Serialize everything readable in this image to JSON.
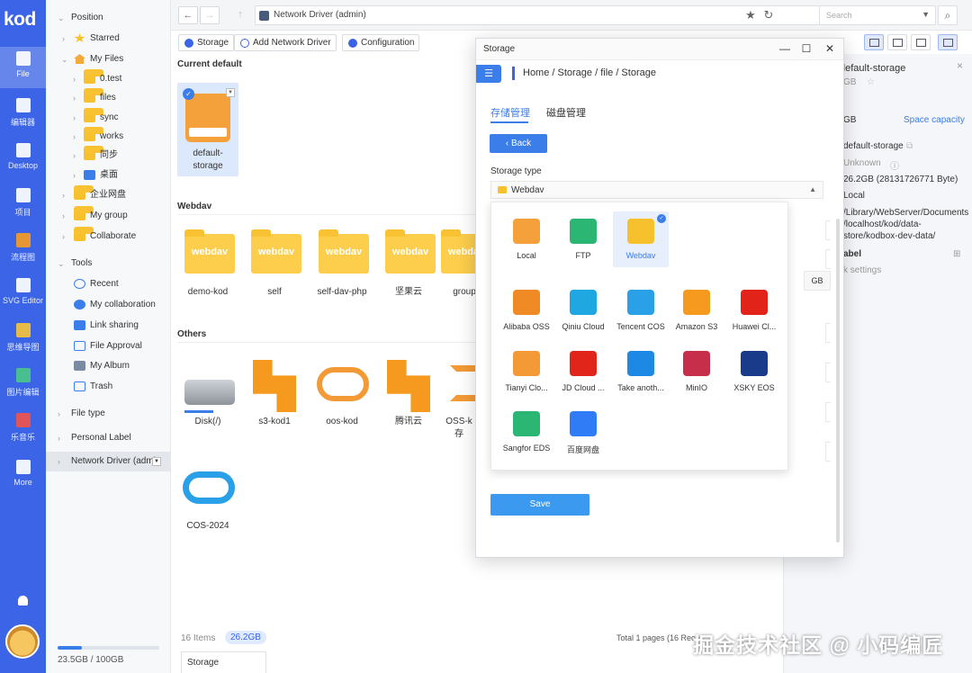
{
  "app": {
    "logo": "kod"
  },
  "rail": [
    {
      "label": "File",
      "icon": "file-icon",
      "active": true
    },
    {
      "label": "编辑器",
      "icon": "editor-icon"
    },
    {
      "label": "Desktop",
      "icon": "desktop-icon"
    },
    {
      "label": "项目",
      "icon": "project-icon"
    },
    {
      "label": "流程图",
      "icon": "flowchart-icon"
    },
    {
      "label": "SVG Editor",
      "icon": "svg-editor-icon"
    },
    {
      "label": "思维导图",
      "icon": "mindmap-icon"
    },
    {
      "label": "图片编辑",
      "icon": "image-editor-icon"
    },
    {
      "label": "乐音乐",
      "icon": "music-icon"
    },
    {
      "label": "More",
      "icon": "more-icon"
    }
  ],
  "tree": {
    "position": "Position",
    "starred": "Starred",
    "my_files": "My Files",
    "folders": [
      "0.test",
      "files",
      "sync",
      "works",
      "同步",
      "桌面"
    ],
    "enterprise": "企业网盘",
    "my_group": "My group",
    "collaborate": "Collaborate",
    "tools": "Tools",
    "recent": "Recent",
    "my_collaboration": "My collaboration",
    "link_sharing": "Link sharing",
    "file_approval": "File Approval",
    "my_album": "My Album",
    "trash": "Trash",
    "file_type": "File type",
    "personal_label": "Personal Label",
    "network_driver": "Network Driver (admi",
    "usage": "23.5GB / 100GB",
    "usage_fraction": 0.235
  },
  "topbar": {
    "address": "Network Driver (admin)",
    "search_placeholder": "Search"
  },
  "actions": {
    "storage": "Storage",
    "add_network_driver": "Add Network Driver",
    "configuration": "Configuration"
  },
  "files": {
    "current_default": "Current default",
    "default_item": "default-storage",
    "webdav": "Webdav",
    "webdav_items": [
      "demo-kod",
      "self",
      "self-dav-php",
      "坚果云",
      "group"
    ],
    "folder_label": "webdav",
    "others": "Others",
    "other_items": [
      "Disk(/)",
      "s3-kod1",
      "oos-kod",
      "腾讯云",
      "OSS-k",
      "COS-2024"
    ],
    "other_sub": "存",
    "count": "16 Items",
    "size": "26.2GB",
    "pages": "Total 1 pages (16 Rec",
    "tab": "Storage"
  },
  "info": {
    "title": "default-storage",
    "size_short": "GB",
    "capacity_left": "GB",
    "space_capacity": "Space capacity",
    "name": "default-storage",
    "owner": "Unknown",
    "size": "26.2GB (28131726771 Byte)",
    "type": "Local",
    "path": [
      "/Library/WebServer/Documents",
      "/localhost/kod/data-",
      "store/kodbox-dev-data/"
    ],
    "label": "abel",
    "settings": "k settings"
  },
  "dialog": {
    "title": "Storage",
    "crumb": "Home  /  Storage / file  /  Storage",
    "tab_storage": "存储管理",
    "tab_disk": "磁盘管理",
    "back": "Back",
    "storage_type_label": "Storage type",
    "storage_type_value": "Webdav",
    "unit": "GB",
    "save": "Save"
  },
  "picker": [
    {
      "label": "Local",
      "color": "#f5a13b"
    },
    {
      "label": "FTP",
      "color": "#2bb673"
    },
    {
      "label": "Webdav",
      "color": "#f6c12c",
      "selected": true
    },
    {
      "label": "Alibaba OSS",
      "color": "#f08a24"
    },
    {
      "label": "Qiniu Cloud",
      "color": "#1ea7e1"
    },
    {
      "label": "Tencent COS",
      "color": "#2aa0e8"
    },
    {
      "label": "Amazon S3",
      "color": "#f59a1f"
    },
    {
      "label": "Huawei Cl...",
      "color": "#e2231a"
    },
    {
      "label": "Tianyi Clo...",
      "color": "#f39a36"
    },
    {
      "label": "JD Cloud ...",
      "color": "#e1251b"
    },
    {
      "label": "Take anoth...",
      "color": "#1e88e5"
    },
    {
      "label": "MinIO",
      "color": "#c72e49"
    },
    {
      "label": "XSKY EOS",
      "color": "#1a3a8a"
    },
    {
      "label": "Sangfor EDS",
      "color": "#2bb673"
    },
    {
      "label": "百度网盘",
      "color": "#2f7cf6"
    }
  ],
  "watermark": "掘金技术社区 @ 小码编匠"
}
